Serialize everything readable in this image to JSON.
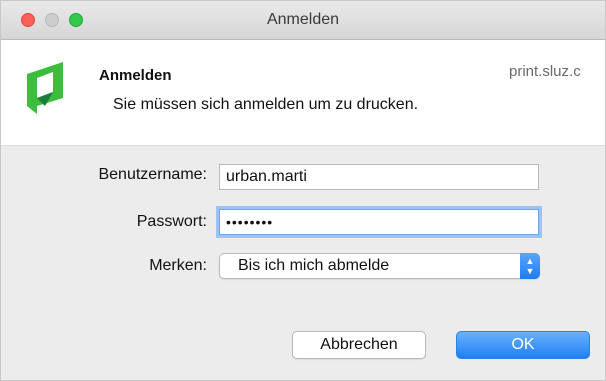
{
  "window": {
    "title": "Anmelden"
  },
  "header": {
    "heading": "Anmelden",
    "message": "Sie müssen sich anmelden um zu drucken.",
    "server": "print.sluz.c"
  },
  "form": {
    "username_label": "Benutzername:",
    "username_value": "urban.marti",
    "password_label": "Passwort:",
    "password_value": "••••••••",
    "remember_label": "Merken:",
    "remember_value": "Bis ich mich abmelde"
  },
  "buttons": {
    "cancel": "Abbrechen",
    "ok": "OK"
  },
  "colors": {
    "accent": "#1f7ff5",
    "close": "#fc5f57",
    "maximize": "#34c84a",
    "logo_green": "#3dbd3d"
  },
  "icons": {
    "close": "close-window-icon",
    "minimize": "minimize-window-icon",
    "maximize": "maximize-window-icon",
    "logo": "papercut-logo-icon",
    "select_arrows": "up-down-chevron-icon"
  }
}
